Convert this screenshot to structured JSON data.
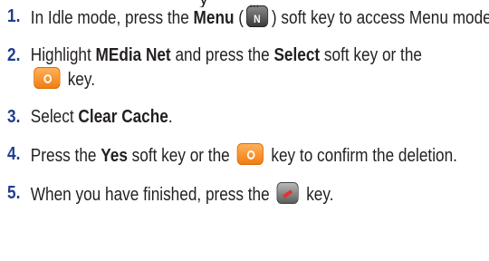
{
  "top_cutoff": "y",
  "steps": [
    {
      "number": "1.",
      "t1": "In Idle mode, press the ",
      "b1": "Menu",
      "t2": " (",
      "t3": ") soft key to access Menu mode.",
      "icon": "menu-soft-key-icon"
    },
    {
      "number": "2.",
      "t1": "Highlight ",
      "b1": "MEdia Net",
      "t2": " and press the ",
      "b2": "Select",
      "t3": " soft key or the ",
      "t4": " key.",
      "icon": "ok-key-icon"
    },
    {
      "number": "3.",
      "t1": "Select ",
      "b1": "Clear Cache",
      "t2": "."
    },
    {
      "number": "4.",
      "t1": "Press the ",
      "b1": "Yes",
      "t2": " soft key or the ",
      "t3": " key to confirm the deletion.",
      "icon": "ok-key-icon"
    },
    {
      "number": "5.",
      "t1": "When you have finished, press the ",
      "t2": " key.",
      "icon": "end-key-icon"
    }
  ]
}
